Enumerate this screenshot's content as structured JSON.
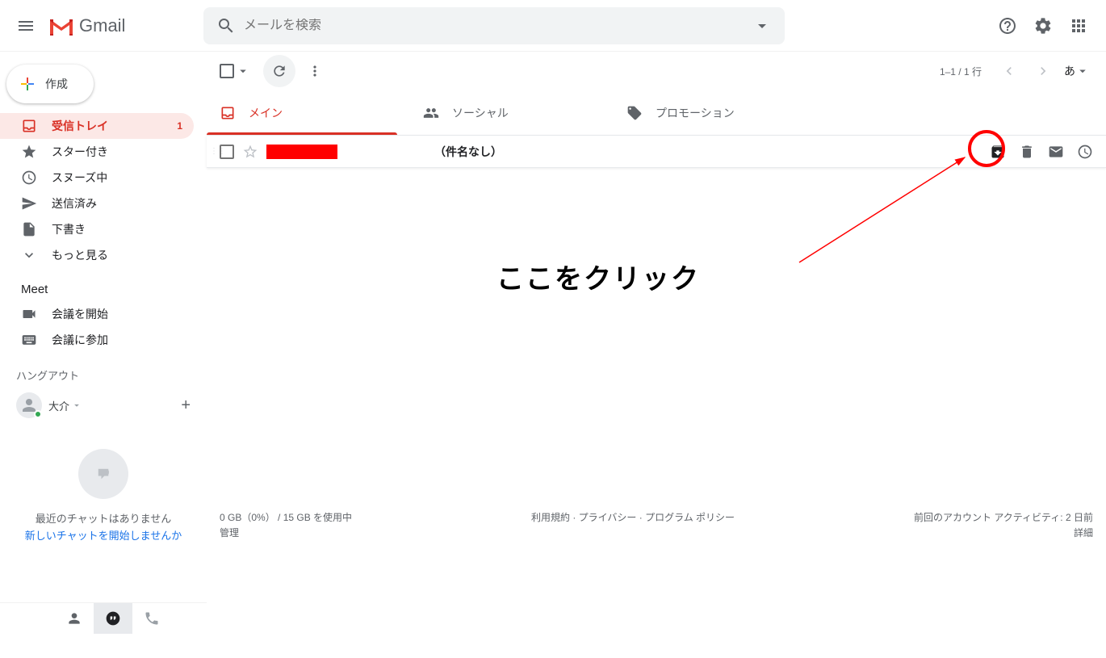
{
  "header": {
    "app_name": "Gmail",
    "search_placeholder": "メールを検索"
  },
  "compose_label": "作成",
  "sidebar": {
    "items": [
      {
        "label": "受信トレイ",
        "count": "1"
      },
      {
        "label": "スター付き"
      },
      {
        "label": "スヌーズ中"
      },
      {
        "label": "送信済み"
      },
      {
        "label": "下書き"
      },
      {
        "label": "もっと見る"
      }
    ],
    "meet_header": "Meet",
    "meet_items": [
      {
        "label": "会議を開始"
      },
      {
        "label": "会議に参加"
      }
    ],
    "hangout_header": "ハングアウト",
    "hangout_user": "大介",
    "no_chat": "最近のチャットはありません",
    "start_chat": "新しいチャットを開始しませんか"
  },
  "toolbar": {
    "page_count": "1–1 / 1 行",
    "lang": "あ"
  },
  "tabs": [
    {
      "label": "メイン"
    },
    {
      "label": "ソーシャル"
    },
    {
      "label": "プロモーション"
    }
  ],
  "email": {
    "subject": "（件名なし）"
  },
  "annotation": {
    "text": "ここをクリック"
  },
  "footer": {
    "storage_line": "0 GB（0%） / 15 GB を使用中",
    "manage": "管理",
    "terms": "利用規約 · プライバシー · プログラム ポリシー",
    "activity": "前回のアカウント アクティビティ: 2 日前",
    "details": "詳細"
  }
}
